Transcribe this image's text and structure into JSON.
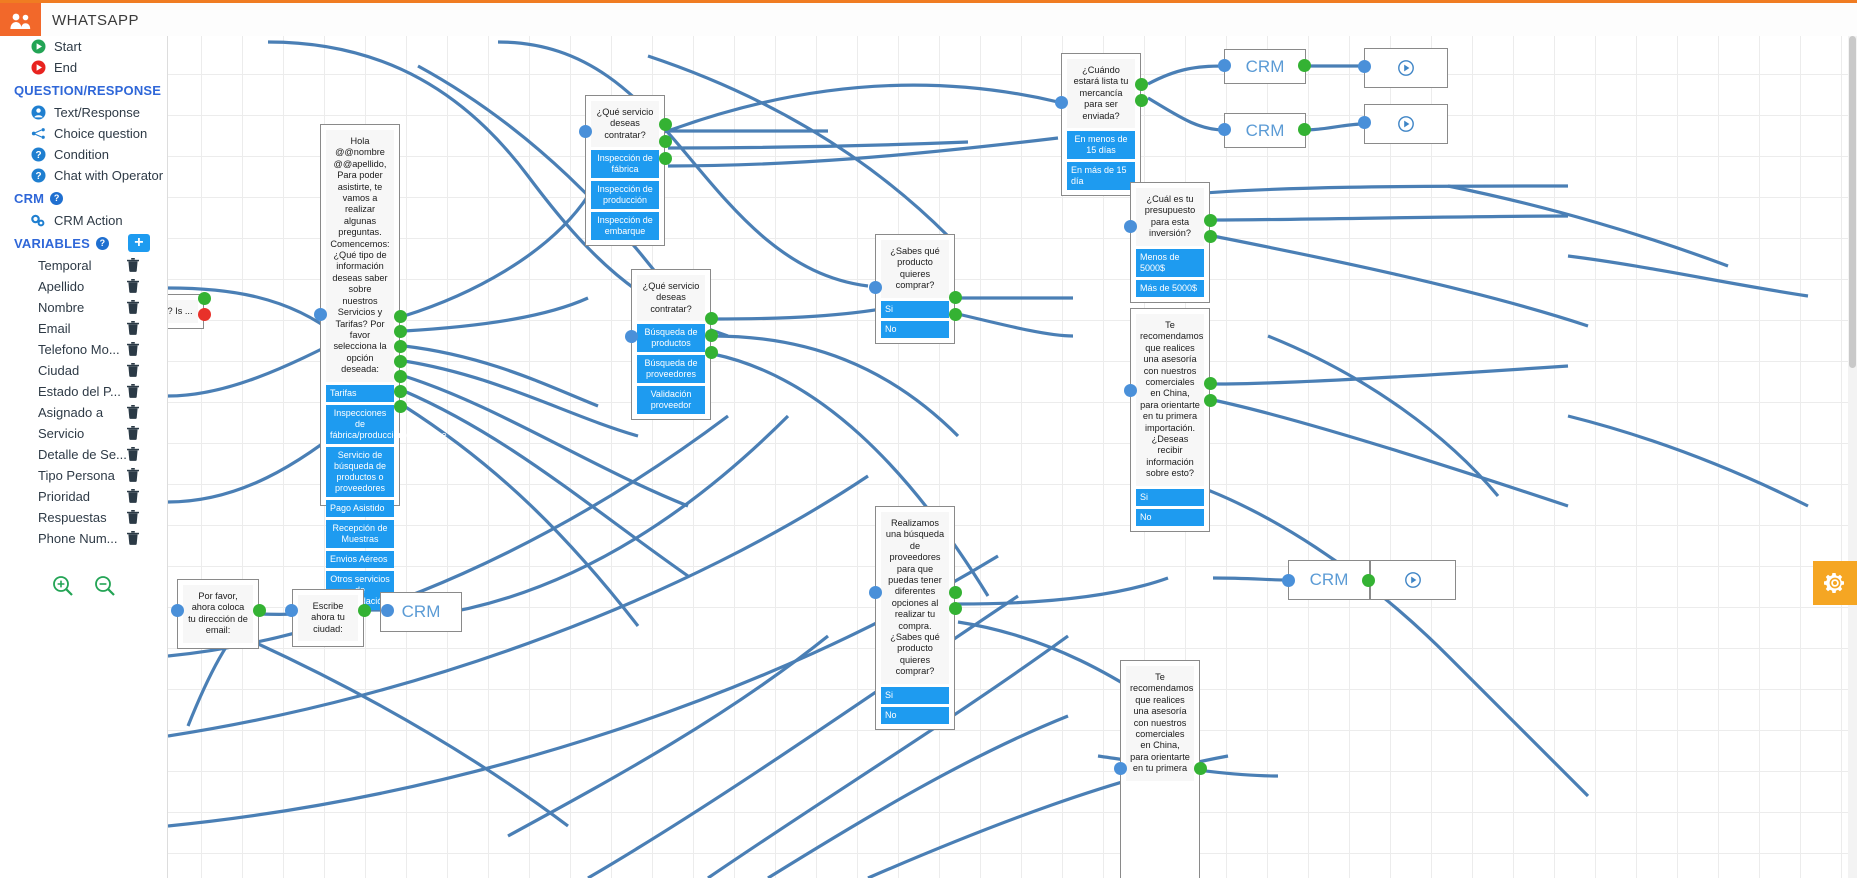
{
  "topbar": {
    "title": "WHATSAPP",
    "logo_icon": "group-users-icon"
  },
  "sidebar": {
    "nodes": [
      {
        "label": "Start",
        "icon": "play-green-icon"
      },
      {
        "label": "End",
        "icon": "stop-red-icon"
      }
    ],
    "sections": [
      {
        "title": "QUESTION/RESPONSE",
        "help": "?"
      },
      {
        "title": "CRM",
        "help": "?"
      },
      {
        "title": "VARIABLES",
        "help": "?"
      }
    ],
    "question_items": [
      {
        "label": "Text/Response",
        "icon": "user-circle-icon"
      },
      {
        "label": "Choice question",
        "icon": "branch-icon"
      },
      {
        "label": "Condition",
        "icon": "question-circle-icon"
      },
      {
        "label": "Chat with Operator",
        "icon": "question-circle-icon"
      }
    ],
    "crm_items": [
      {
        "label": "CRM Action",
        "icon": "gears-icon"
      }
    ],
    "add_variable_label": "+",
    "variables": [
      "Temporal",
      "Apellido",
      "Nombre",
      "Email",
      "Telefono Mo...",
      "Ciudad",
      "Estado del P...",
      "Asignado a",
      "Servicio",
      "Detalle de Se...",
      "Tipo Persona",
      "Prioridad",
      "Respuestas",
      "Phone Num..."
    ],
    "zoom_in_icon": "zoom-in-icon",
    "zoom_out_icon": "zoom-out-icon"
  },
  "canvas": {
    "settings_fab_icon": "gear-icon",
    "nodes": {
      "welcome": {
        "text": "Hola @@nombre @@apellido, Para poder asistirte, te vamos a realizar algunas preguntas. Comencemos: ¿Qué tipo de información deseas saber sobre nuestros Servicios y Tarifas? Por favor selecciona la opción deseada:",
        "options": [
          "Tarifas",
          "Inspecciones de fábrica/producción/embarque",
          "Servicio de búsqueda de productos o proveedores",
          "Pago Asistido",
          "Recepción de Muestras",
          "Envios Aéreos",
          "Otros servicios de consolidación"
        ]
      },
      "service_inspection": {
        "text": "¿Qué servicio deseas contratar?",
        "options": [
          "Inspección de fábrica",
          "Inspección de producción",
          "Inspección de embarque"
        ]
      },
      "service_search": {
        "text": "¿Qué servicio deseas contratar?",
        "options": [
          "Búsqueda de productos",
          "Búsqueda de proveedores",
          "Validación proveedor"
        ]
      },
      "know_product": {
        "text": "¿Sabes qué producto quieres comprar?",
        "options": [
          "Si",
          "No"
        ]
      },
      "merchandise_ready": {
        "text": "¿Cuándo estará lista tu mercancía para ser enviada?",
        "options": [
          "En menos de 15 días",
          "En más de 15 día"
        ]
      },
      "budget": {
        "text": "¿Cuál es tu presupuesto para esta inversión?",
        "options": [
          "Menos de 5000$",
          "Más de 5000$"
        ]
      },
      "advisory_1": {
        "text": "Te recomendamos que realices una asesoría con nuestros comerciales en China, para orientarte en tu primera importación. ¿Deseas recibir información sobre esto?",
        "options": [
          "Si",
          "No"
        ]
      },
      "advisory_2": {
        "text": "Te recomendamos que realices una asesoría con nuestros comerciales en China, para orientarte en tu primera",
        "options": []
      },
      "supplier_search": {
        "text": "Realizamos una búsqueda de proveedores para que puedas tener diferentes opciones al realizar tu compra. ¿Sabes qué producto quieres comprar?",
        "options": [
          "Si",
          "No"
        ]
      },
      "email_prompt": {
        "text": "Por favor, ahora coloca tu dirección de email:"
      },
      "city_prompt": {
        "text": "Escribe ahora tu ciudad:"
      },
      "partial_left": {
        "text": "? Is ..."
      }
    },
    "crm_labels": [
      "CRM",
      "CRM",
      "CRM",
      "CRM"
    ],
    "play_icon": "play-circle-icon"
  },
  "colors": {
    "brand_orange": "#f2682a",
    "accent_blue": "#1e9bf0",
    "link_blue": "#2f67d8",
    "edge_blue": "#4a7fb5",
    "port_green": "#34b233",
    "port_blue": "#4a90d9",
    "fab_orange": "#f5a623"
  }
}
